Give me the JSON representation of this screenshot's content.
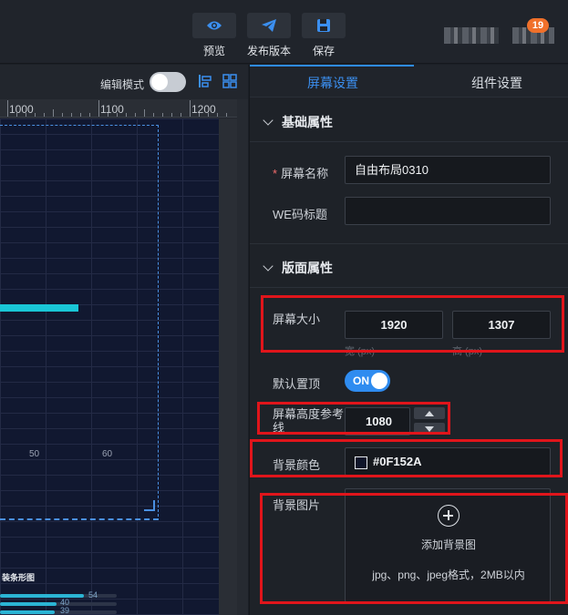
{
  "toolbar": {
    "preview_label": "预览",
    "publish_label": "发布版本",
    "save_label": "保存",
    "notification_count": "19"
  },
  "canvas": {
    "edit_mode_label": "编辑模式",
    "edit_mode_on": false,
    "ruler_labels": [
      "1000",
      "1100",
      "1200"
    ],
    "axis_labels": [
      "50",
      "60"
    ],
    "chart_title": "装条形图",
    "bar_values": [
      "54",
      "40",
      "39"
    ]
  },
  "tabs": {
    "screen_settings": "屏幕设置",
    "component_settings": "组件设置",
    "active": "屏幕设置"
  },
  "basic": {
    "section_title": "基础属性",
    "screen_name_label": "屏幕名称",
    "screen_name_value": "自由布局0310",
    "we_title_label": "WE码标题",
    "we_title_value": ""
  },
  "layout": {
    "section_title": "版面属性",
    "screen_size_label": "屏幕大小",
    "width_value": "1920",
    "height_value": "1307",
    "width_hint": "宽 (px)",
    "height_hint": "高 (px)",
    "default_top_label": "默认置顶",
    "default_top_state": "ON",
    "ref_line_label": "屏幕高度参考线",
    "ref_line_value": "1080",
    "bg_color_label": "背景颜色",
    "bg_color_value": "#0F152A",
    "bg_image_label": "背景图片",
    "upload_label": "添加背景图",
    "upload_hint": "jpg、png、jpeg格式，2MB以内"
  },
  "colors": {
    "accent": "#2f8cf0",
    "highlight": "#e0151b",
    "canvas_bg": "#0F152A"
  }
}
